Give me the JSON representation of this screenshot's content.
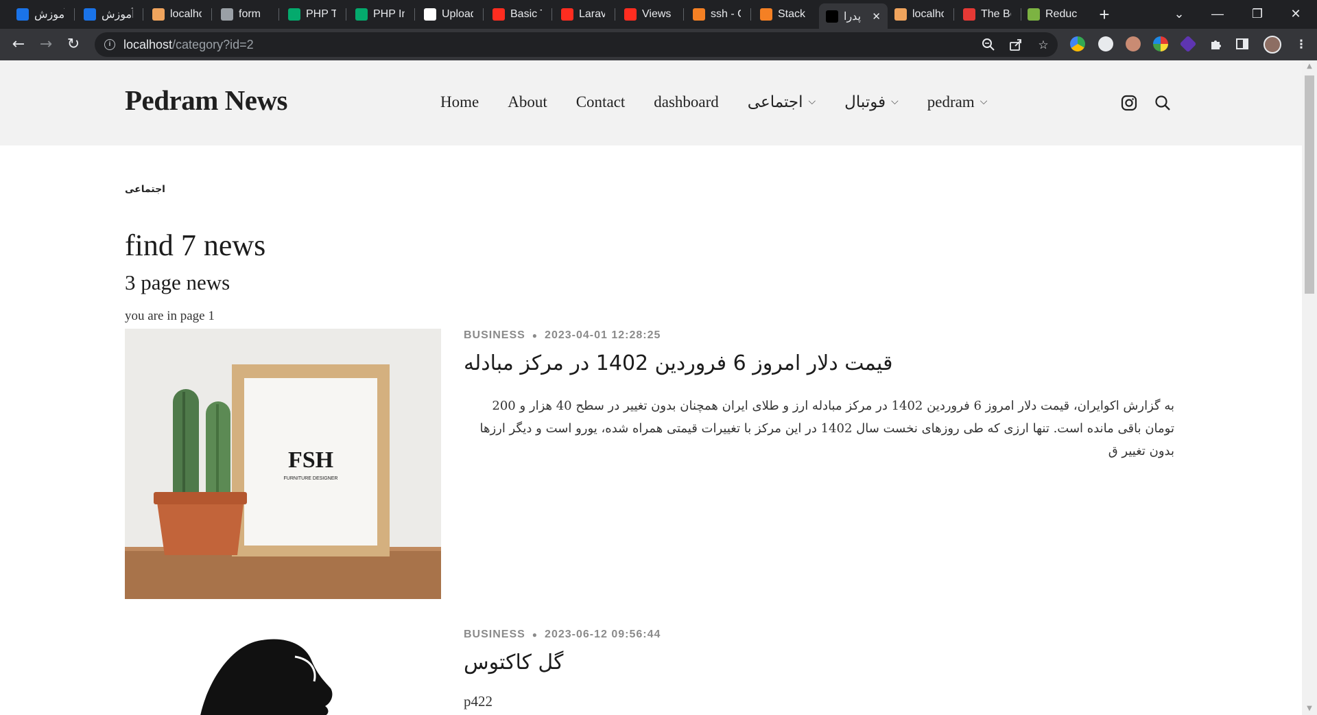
{
  "browser": {
    "tabs": [
      {
        "label": "آموزش",
        "icon": "tab-favicon-blue",
        "color": "#1a73e8"
      },
      {
        "label": "آموزش",
        "icon": "tab-favicon-blue",
        "color": "#1a73e8"
      },
      {
        "label": "localho",
        "icon": "tab-favicon-laravel",
        "color": "#f0a45d"
      },
      {
        "label": "form",
        "icon": "tab-favicon-globe",
        "color": "#9aa0a6"
      },
      {
        "label": "PHP Tu",
        "icon": "tab-favicon-w3",
        "color": "#04aa6d"
      },
      {
        "label": "PHP Int",
        "icon": "tab-favicon-w3",
        "color": "#04aa6d"
      },
      {
        "label": "Upload",
        "icon": "tab-favicon-github",
        "color": "#ffffff"
      },
      {
        "label": "Basic Ta",
        "icon": "tab-favicon-laravel-red",
        "color": "#ff2d20"
      },
      {
        "label": "Laravel",
        "icon": "tab-favicon-laravel-red",
        "color": "#ff2d20"
      },
      {
        "label": "Views -",
        "icon": "tab-favicon-laravel-red",
        "color": "#ff2d20"
      },
      {
        "label": "ssh - G",
        "icon": "tab-favicon-stackoverflow",
        "color": "#f48024"
      },
      {
        "label": "Stack O",
        "icon": "tab-favicon-stackoverflow",
        "color": "#f48024"
      },
      {
        "label": "پدرا",
        "icon": "tab-favicon-site",
        "color": "#000000"
      },
      {
        "label": "localho",
        "icon": "tab-favicon-laravel",
        "color": "#f0a45d"
      },
      {
        "label": "The Be",
        "icon": "tab-favicon-target",
        "color": "#e53935"
      },
      {
        "label": "Reduce",
        "icon": "tab-favicon-green",
        "color": "#7cb342"
      }
    ],
    "active_tab_index": 12,
    "active_tab_close": "✕",
    "new_tab": "+",
    "url_host": "localhost",
    "url_path": "/category?id=2"
  },
  "site": {
    "brand": "Pedram News",
    "nav": [
      {
        "label": "Home",
        "dropdown": false
      },
      {
        "label": "About",
        "dropdown": false
      },
      {
        "label": "Contact",
        "dropdown": false
      },
      {
        "label": "dashboard",
        "dropdown": false
      },
      {
        "label": "اجتماعی",
        "dropdown": true
      },
      {
        "label": "فوتبال",
        "dropdown": true
      },
      {
        "label": "pedram",
        "dropdown": true
      }
    ]
  },
  "category": {
    "label": "اجتماعی",
    "count_text": "find 7 news",
    "pages_text": "3 page news",
    "current_page_text": "you are in page 1"
  },
  "posts": [
    {
      "category": "BUSINESS",
      "date": "2023-04-01 12:28:25",
      "title": "قیمت دلار امروز 6 فروردین 1402 در مرکز مبادله",
      "excerpt": "به گزارش اکوایران، قیمت دلار امروز 6 فروردین 1402 در مرکز مبادله ارز و طلای ایران همچنان بدون تغییر در سطح 40 هزار و 200 تومان باقی مانده است. تنها ارزی که طی روزهای نخست سال 1402 در این مرکز با تغییرات قیمتی همراه شده، یورو است و دیگر ارزها بدون تغییر ق",
      "image_logo": "FSH",
      "image_caption": "FURNITURE DESIGNER"
    },
    {
      "category": "BUSINESS",
      "date": "2023-06-12 09:56:44",
      "title": "گل کاکتوس",
      "excerpt": "p422"
    }
  ]
}
